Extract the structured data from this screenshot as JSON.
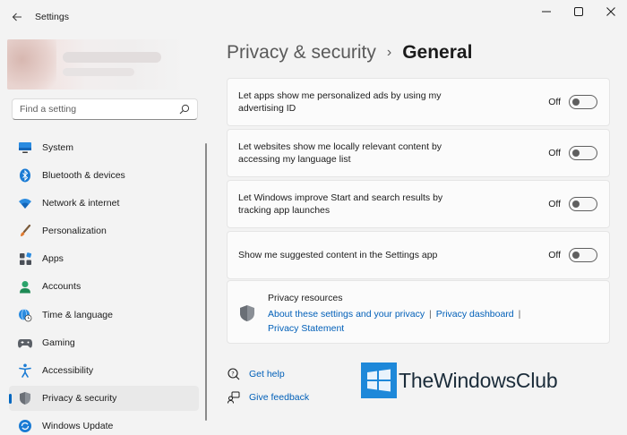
{
  "window": {
    "title": "Settings"
  },
  "search": {
    "placeholder": "Find a setting"
  },
  "sidebar": {
    "items": [
      {
        "label": "System",
        "icon": "monitor-icon"
      },
      {
        "label": "Bluetooth & devices",
        "icon": "bluetooth-icon"
      },
      {
        "label": "Network & internet",
        "icon": "wifi-icon"
      },
      {
        "label": "Personalization",
        "icon": "brush-icon"
      },
      {
        "label": "Apps",
        "icon": "apps-icon"
      },
      {
        "label": "Accounts",
        "icon": "person-icon"
      },
      {
        "label": "Time & language",
        "icon": "globe-clock-icon"
      },
      {
        "label": "Gaming",
        "icon": "gamepad-icon"
      },
      {
        "label": "Accessibility",
        "icon": "accessibility-icon"
      },
      {
        "label": "Privacy & security",
        "icon": "shield-icon",
        "active": true
      },
      {
        "label": "Windows Update",
        "icon": "update-icon"
      }
    ]
  },
  "breadcrumb": {
    "parent": "Privacy & security",
    "separator": "›",
    "current": "General"
  },
  "settings": [
    {
      "text": "Let apps show me personalized ads by using my advertising ID",
      "state": "Off",
      "on": false
    },
    {
      "text": "Let websites show me locally relevant content by accessing my language list",
      "state": "Off",
      "on": false
    },
    {
      "text": "Let Windows improve Start and search results by tracking app launches",
      "state": "Off",
      "on": false
    },
    {
      "text": "Show me suggested content in the Settings app",
      "state": "Off",
      "on": false
    }
  ],
  "resources": {
    "title": "Privacy resources",
    "link_about": "About these settings and your privacy",
    "link_dashboard": "Privacy dashboard",
    "link_statement": "Privacy Statement",
    "pipe": "|"
  },
  "help": {
    "get_help": "Get help",
    "give_feedback": "Give feedback"
  },
  "watermark": {
    "text": "TheWindowsClub"
  },
  "colors": {
    "accent": "#0067c0",
    "link": "#005fb8",
    "background": "#f3f3f3",
    "card": "#fbfbfb"
  }
}
